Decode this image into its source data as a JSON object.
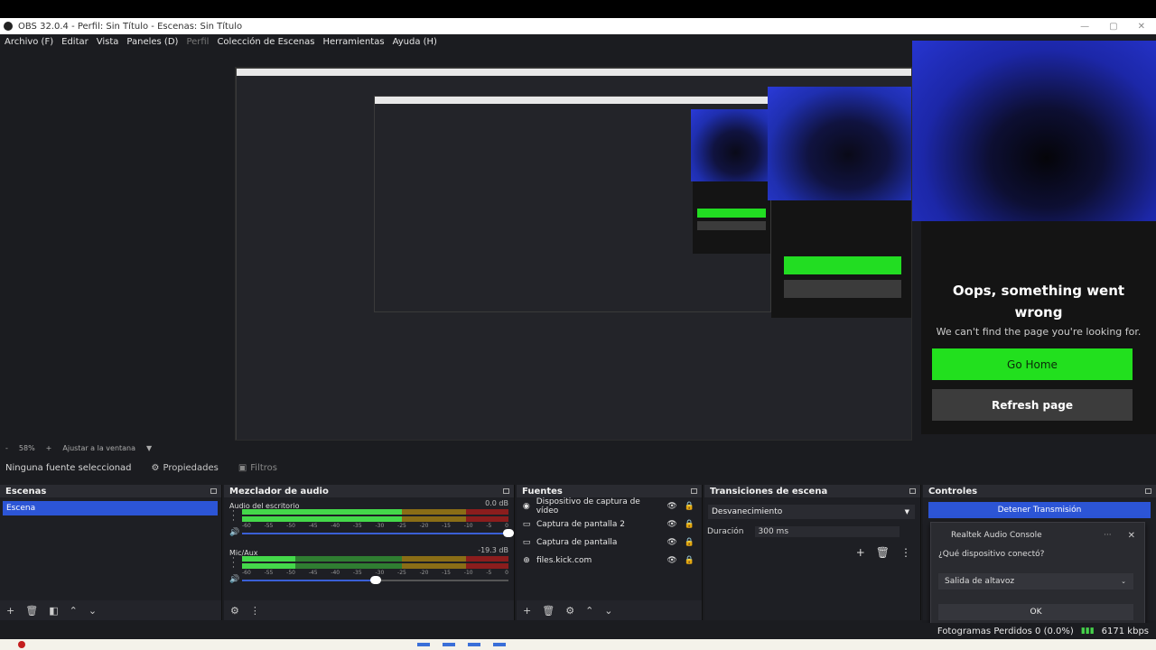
{
  "window": {
    "title": "OBS 32.0.4 - Perfil: Sin Título - Escenas: Sin Título"
  },
  "menu": [
    "Archivo (F)",
    "Editar",
    "Vista",
    "Paneles (D)",
    "Perfil",
    "Colección de Escenas",
    "Herramientas",
    "Ayuda (H)"
  ],
  "preview": {
    "error_title": "Oops, something went wrong",
    "error_subtitle": "We can't find the page you're looking for.",
    "go_home": "Go Home",
    "refresh": "Refresh page"
  },
  "zoom": {
    "minus": "-",
    "level": "58%",
    "plus": "+",
    "fit": "Ajustar a la ventana"
  },
  "source_toolbar": {
    "no_source": "Ninguna fuente seleccionad",
    "properties": "Propiedades",
    "filters": "Filtros"
  },
  "scenes": {
    "title": "Escenas",
    "items": [
      "Escena"
    ]
  },
  "mixer": {
    "title": "Mezclador de audio",
    "channels": [
      {
        "name": "Audio del escritorio",
        "db": "0.0 dB",
        "level": 0.6,
        "volume": 1.0
      },
      {
        "name": "Mic/Aux",
        "db": "-19.3 dB",
        "level": 0.2,
        "volume": 0.5
      }
    ],
    "ticks": [
      "-60",
      "-55",
      "-50",
      "-45",
      "-40",
      "-35",
      "-30",
      "-25",
      "-20",
      "-15",
      "-10",
      "-5",
      "0"
    ]
  },
  "sources": {
    "title": "Fuentes",
    "items": [
      {
        "icon": "camera-icon",
        "name": "Dispositivo de captura de vídeo",
        "glyph": "◉"
      },
      {
        "icon": "monitor-icon",
        "name": "Captura de pantalla 2",
        "glyph": "▭"
      },
      {
        "icon": "monitor-icon",
        "name": "Captura de pantalla",
        "glyph": "▭"
      },
      {
        "icon": "globe-icon",
        "name": "files.kick.com",
        "glyph": "⊕"
      }
    ]
  },
  "transitions": {
    "title": "Transiciones de escena",
    "selected": "Desvanecimiento",
    "duration_label": "Duración",
    "duration_value": "300 ms"
  },
  "controls": {
    "title": "Controles",
    "stop_stream": "Detener Transmisión"
  },
  "realtek": {
    "title": "Realtek Audio Console",
    "more": "···",
    "question": "¿Qué dispositivo conectó?",
    "device": "Salida de altavoz",
    "ok": "OK"
  },
  "status": {
    "dropped": "Fotogramas Perdidos 0 (0.0%)",
    "bitrate": "6171 kbps"
  },
  "colors": {
    "accent": "#2c55d6",
    "green": "#22e01e",
    "panel": "#1e1f24"
  }
}
